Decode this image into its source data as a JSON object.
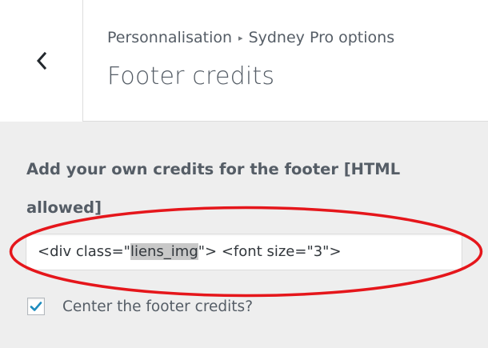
{
  "header": {
    "back_icon": "chevron-left-icon",
    "breadcrumb": {
      "parent": "Personnalisation",
      "separator": "▸",
      "section": "Sydney Pro options"
    },
    "title": "Footer credits"
  },
  "control": {
    "label": "Add your own credits for the footer [HTML allowed]",
    "input": {
      "value_before": "<div class=\"",
      "value_selected": "liens_img",
      "value_after": "\">   <font size=\"3\">"
    },
    "checkbox": {
      "label": "Center the footer credits?",
      "checked": true
    }
  },
  "annotation": {
    "color": "#e5161b"
  },
  "colors": {
    "accent": "#1e8cbe",
    "background": "#eeeeee"
  }
}
